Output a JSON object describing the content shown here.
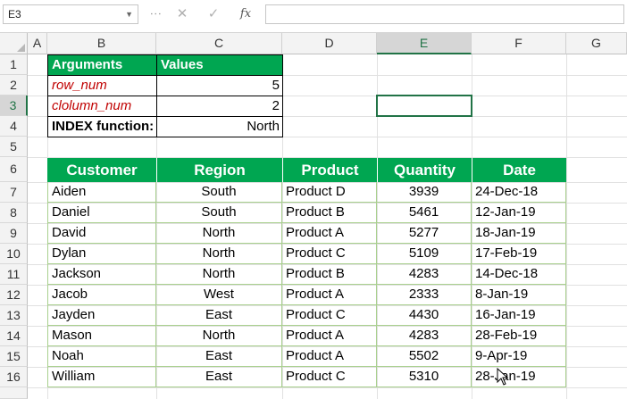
{
  "formula_bar": {
    "name_box": "E3",
    "cancel_icon": "✕",
    "enter_icon": "✓",
    "fx_label": "fx",
    "formula": ""
  },
  "columns": [
    "A",
    "B",
    "C",
    "D",
    "E",
    "F",
    "G"
  ],
  "rows": [
    "1",
    "2",
    "3",
    "4",
    "5",
    "6",
    "7",
    "8",
    "9",
    "10",
    "11",
    "12",
    "13",
    "14",
    "15",
    "16"
  ],
  "selected_cell": {
    "column": "E",
    "row": "3"
  },
  "args_table": {
    "headers": [
      "Arguments",
      "Values"
    ],
    "rows": [
      {
        "arg": "row_num",
        "value": "5"
      },
      {
        "arg": "clolumn_num",
        "value": "2"
      },
      {
        "arg": "INDEX function:",
        "value": "North"
      }
    ]
  },
  "data_table": {
    "headers": [
      "Customer",
      "Region",
      "Product",
      "Quantity",
      "Date"
    ],
    "rows": [
      [
        "Aiden",
        "South",
        "Product D",
        "3939",
        "24-Dec-18"
      ],
      [
        "Daniel",
        "South",
        "Product B",
        "5461",
        "12-Jan-19"
      ],
      [
        "David",
        "North",
        "Product A",
        "5277",
        "18-Jan-19"
      ],
      [
        "Dylan",
        "North",
        "Product C",
        "5109",
        "17-Feb-19"
      ],
      [
        "Jackson",
        "North",
        "Product B",
        "4283",
        "14-Dec-18"
      ],
      [
        "Jacob",
        "West",
        "Product A",
        "2333",
        "8-Jan-19"
      ],
      [
        "Jayden",
        "East",
        "Product C",
        "4430",
        "16-Jan-19"
      ],
      [
        "Mason",
        "North",
        "Product A",
        "4283",
        "28-Feb-19"
      ],
      [
        "Noah",
        "East",
        "Product A",
        "5502",
        "9-Apr-19"
      ],
      [
        "William",
        "East",
        "Product C",
        "5310",
        "28-Jan-19"
      ]
    ]
  },
  "colors": {
    "header_green": "#00a651",
    "arg_red": "#c00000",
    "excel_green": "#217346"
  }
}
